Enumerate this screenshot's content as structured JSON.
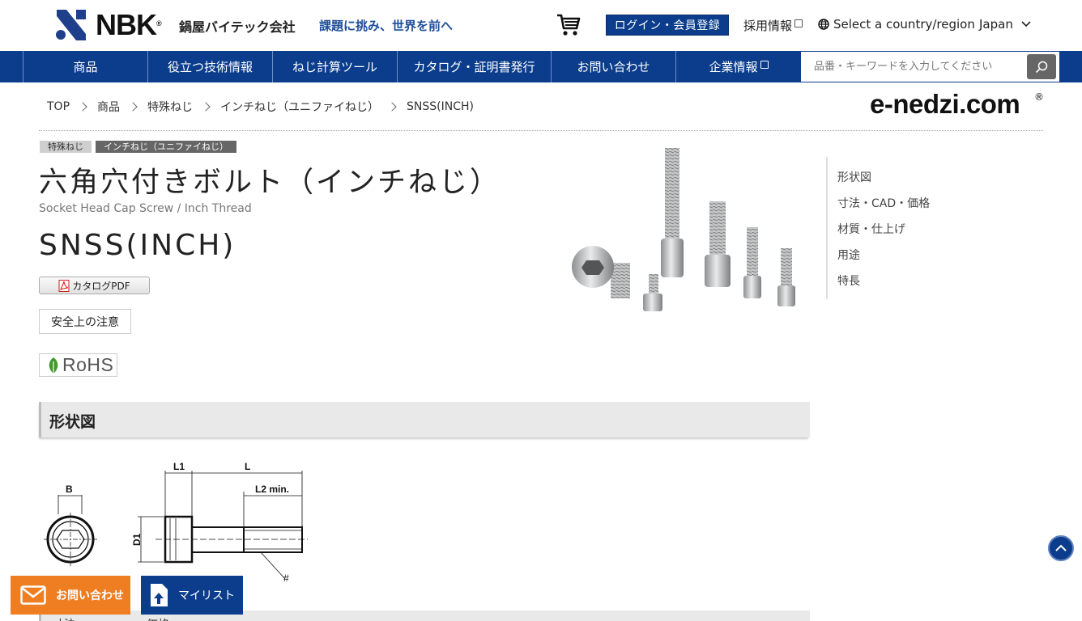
{
  "header": {
    "logo_text": "NBK",
    "logo_reg": "®",
    "company_name": "鍋屋バイテック会社",
    "tagline": "課題に挑み、世界を前へ",
    "login_label": "ログイン・会員登録",
    "recruit_label": "採用情報",
    "country_label": "Select a country/region",
    "region_value": "Japan"
  },
  "nav": {
    "items": [
      "商品",
      "役立つ技術情報",
      "ねじ計算ツール",
      "カタログ・証明書発行",
      "お問い合わせ",
      "企業情報"
    ],
    "search_placeholder": "品番・キーワードを入力してください"
  },
  "breadcrumb": [
    "TOP",
    "商品",
    "特殊ねじ",
    "インチねじ（ユニファイねじ）",
    "SNSS(INCH)"
  ],
  "brand": {
    "text": "e-nedzi.com",
    "reg": "®"
  },
  "product": {
    "tags": [
      "特殊ねじ",
      "インチねじ（ユニファイねじ）"
    ],
    "title": "六角穴付きボルト（インチねじ）",
    "subtitle": "Socket Head Cap Screw / Inch Thread",
    "code": "SNSS(INCH)",
    "catalog_label": "カタログPDF",
    "safety_label": "安全上の注意",
    "rohs_label": "RoHS"
  },
  "side_nav": [
    "形状図",
    "寸法・CAD・価格",
    "材質・仕上げ",
    "用途",
    "特長"
  ],
  "sections": {
    "shape_title": "形状図",
    "next_col1": "寸法",
    "next_col2": "価格"
  },
  "diagram_labels": {
    "b": "B",
    "l1": "L1",
    "l": "L",
    "l2": "L2 min.",
    "d1": "D1",
    "hash": "#"
  },
  "floating": {
    "contact_label": "お問い合わせ",
    "mylist_label": "マイリスト"
  },
  "colors": {
    "nav_blue": "#0b3d8c",
    "contact_orange": "#ef7d22",
    "tagline_blue": "#1f4f9a"
  }
}
